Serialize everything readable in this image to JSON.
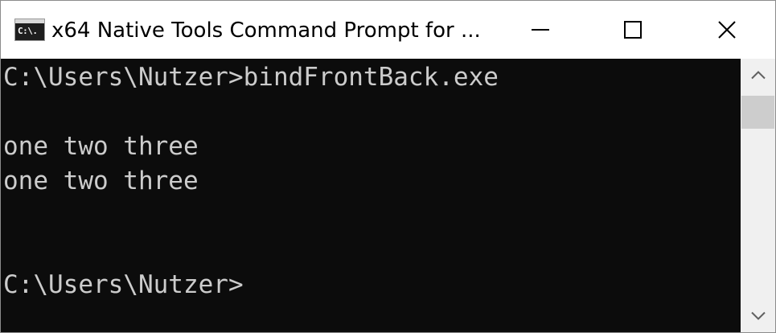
{
  "window": {
    "title": "x64 Native Tools Command Prompt for ...",
    "icon_label": "C:\\."
  },
  "console": {
    "lines": [
      "C:\\Users\\Nutzer>bindFrontBack.exe",
      "one two three",
      "one two three",
      "C:\\Users\\Nutzer>"
    ]
  },
  "icons": {
    "app": "command-prompt-icon",
    "minimize": "minimize-icon",
    "maximize": "maximize-icon",
    "close": "close-icon",
    "scroll_up": "chevron-up-icon",
    "scroll_down": "chevron-down-icon"
  },
  "colors": {
    "console_background": "#0c0c0c",
    "console_text": "#cccccc",
    "titlebar_background": "#ffffff",
    "scrollbar_track": "#f0f0f0",
    "scrollbar_thumb": "#cdcdcd"
  }
}
